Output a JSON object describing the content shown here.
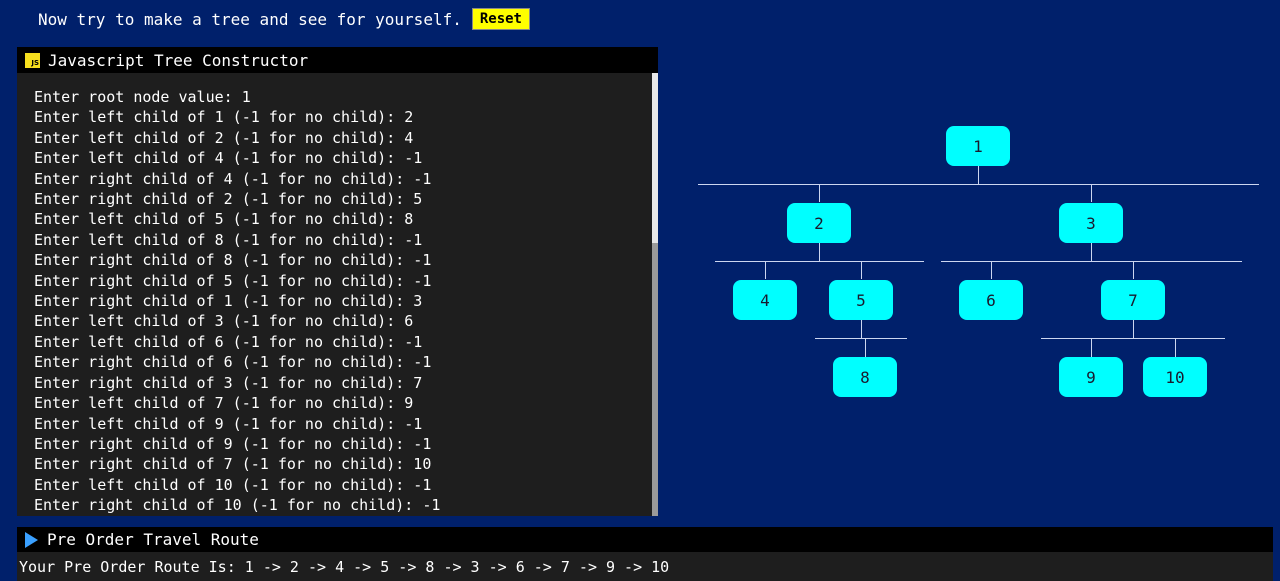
{
  "top": {
    "prompt": "Now try to make a tree and see for yourself.",
    "reset_label": "Reset"
  },
  "console": {
    "icon_text": "JS",
    "title": "Javascript Tree Constructor",
    "lines": [
      "Enter root node value: 1",
      "Enter left child of 1 (-1 for no child): 2",
      "Enter left child of 2 (-1 for no child): 4",
      "Enter left child of 4 (-1 for no child): -1",
      "Enter right child of 4 (-1 for no child): -1",
      "Enter right child of 2 (-1 for no child): 5",
      "Enter left child of 5 (-1 for no child): 8",
      "Enter left child of 8 (-1 for no child): -1",
      "Enter right child of 8 (-1 for no child): -1",
      "Enter right child of 5 (-1 for no child): -1",
      "Enter right child of 1 (-1 for no child): 3",
      "Enter left child of 3 (-1 for no child): 6",
      "Enter left child of 6 (-1 for no child): -1",
      "Enter right child of 6 (-1 for no child): -1",
      "Enter right child of 3 (-1 for no child): 7",
      "Enter left child of 7 (-1 for no child): 9",
      "Enter left child of 9 (-1 for no child): -1",
      "Enter right child of 9 (-1 for no child): -1",
      "Enter right child of 7 (-1 for no child): 10",
      "Enter left child of 10 (-1 for no child): -1",
      "Enter right child of 10 (-1 for no child): -1"
    ]
  },
  "tree": {
    "nodes": [
      {
        "id": "1",
        "label": "1"
      },
      {
        "id": "2",
        "label": "2"
      },
      {
        "id": "3",
        "label": "3"
      },
      {
        "id": "4",
        "label": "4"
      },
      {
        "id": "5",
        "label": "5"
      },
      {
        "id": "6",
        "label": "6"
      },
      {
        "id": "7",
        "label": "7"
      },
      {
        "id": "8",
        "label": "8"
      },
      {
        "id": "9",
        "label": "9"
      },
      {
        "id": "10",
        "label": "10"
      }
    ],
    "node_color": "#00ffff",
    "line_color": "#ccd6f0"
  },
  "route": {
    "title": "Pre Order Travel Route",
    "result": "Your Pre Order Route Is: 1 -> 2 -> 4 -> 5 -> 8 -> 3 -> 6 -> 7 -> 9 -> 10"
  },
  "colors": {
    "background": "#00206b",
    "accent": "#ffff00",
    "console_bg": "#1e1e1e"
  }
}
